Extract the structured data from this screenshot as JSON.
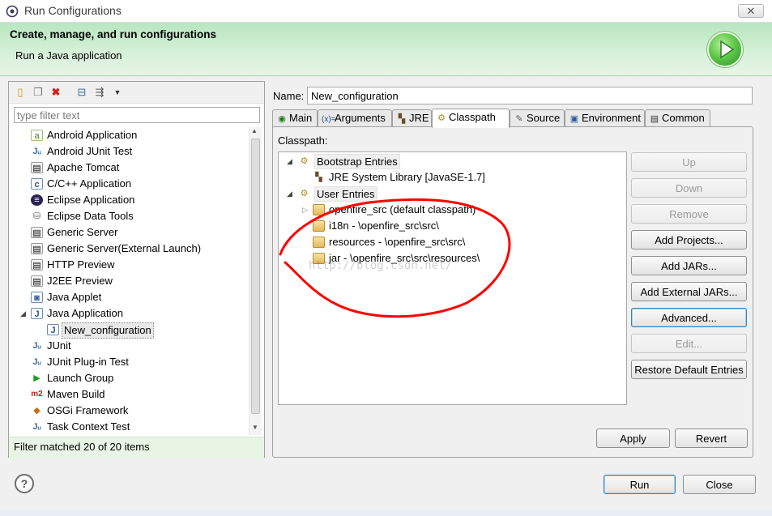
{
  "window": {
    "title": "Run Configurations",
    "close_label": "✕"
  },
  "banner": {
    "heading": "Create, manage, and run configurations",
    "subheading": "Run a Java application",
    "icon": "run-play-icon"
  },
  "left": {
    "filter_placeholder": "type filter text",
    "tree": [
      {
        "label": "Android Application",
        "icon": "android-app-icon"
      },
      {
        "label": "Android JUnit Test",
        "icon": "junit-icon"
      },
      {
        "label": "Apache Tomcat",
        "icon": "tomcat-icon"
      },
      {
        "label": "C/C++ Application",
        "icon": "c-app-icon"
      },
      {
        "label": "Eclipse Application",
        "icon": "eclipse-icon"
      },
      {
        "label": "Eclipse Data Tools",
        "icon": "data-tools-icon"
      },
      {
        "label": "Generic Server",
        "icon": "server-icon"
      },
      {
        "label": "Generic Server(External Launch)",
        "icon": "server-icon"
      },
      {
        "label": "HTTP Preview",
        "icon": "server-icon"
      },
      {
        "label": "J2EE Preview",
        "icon": "server-icon"
      },
      {
        "label": "Java Applet",
        "icon": "applet-icon"
      },
      {
        "label": "Java Application",
        "icon": "java-app-icon"
      },
      {
        "label": "New_configuration",
        "icon": "java-config-icon"
      },
      {
        "label": "JUnit",
        "icon": "junit-icon"
      },
      {
        "label": "JUnit Plug-in Test",
        "icon": "junit-icon"
      },
      {
        "label": "Launch Group",
        "icon": "launch-group-icon"
      },
      {
        "label": "Maven Build",
        "icon": "maven-icon"
      },
      {
        "label": "OSGi Framework",
        "icon": "osgi-icon"
      },
      {
        "label": "Task Context Test",
        "icon": "junit-icon"
      }
    ],
    "filter_status": "Filter matched 20 of 20 items"
  },
  "right": {
    "name_label": "Name:",
    "name_value": "New_configuration",
    "tabs": [
      {
        "label": "Main",
        "icon": "main-tab-icon"
      },
      {
        "label": "Arguments",
        "icon": "arguments-icon"
      },
      {
        "label": "JRE",
        "icon": "jre-icon"
      },
      {
        "label": "Classpath",
        "icon": "classpath-icon"
      },
      {
        "label": "Source",
        "icon": "source-icon"
      },
      {
        "label": "Environment",
        "icon": "environment-icon"
      },
      {
        "label": "Common",
        "icon": "common-icon"
      }
    ],
    "classpath_label": "Classpath:",
    "classpath_tree": [
      {
        "label": "Bootstrap Entries"
      },
      {
        "label": "JRE System Library [JavaSE-1.7]"
      },
      {
        "label": "User Entries"
      },
      {
        "label": "openfire_src (default classpath)"
      },
      {
        "label": "i18n - \\openfire_src\\src\\"
      },
      {
        "label": "resources - \\openfire_src\\src\\"
      },
      {
        "label": "jar - \\openfire_src\\src\\resources\\"
      }
    ],
    "buttons": {
      "up": "Up",
      "down": "Down",
      "remove": "Remove",
      "add_projects": "Add Projects...",
      "add_jars": "Add JARs...",
      "add_external_jars": "Add External JARs...",
      "advanced": "Advanced...",
      "edit": "Edit...",
      "restore": "Restore Default Entries",
      "apply": "Apply",
      "revert": "Revert"
    },
    "watermark": "http://blog.csdn.net/"
  },
  "footer": {
    "help": "?",
    "run": "Run",
    "close": "Close"
  },
  "colors": {
    "banner": "#c8ecc9",
    "annotation": "#ff0000",
    "selection": "#e9e9e9"
  }
}
